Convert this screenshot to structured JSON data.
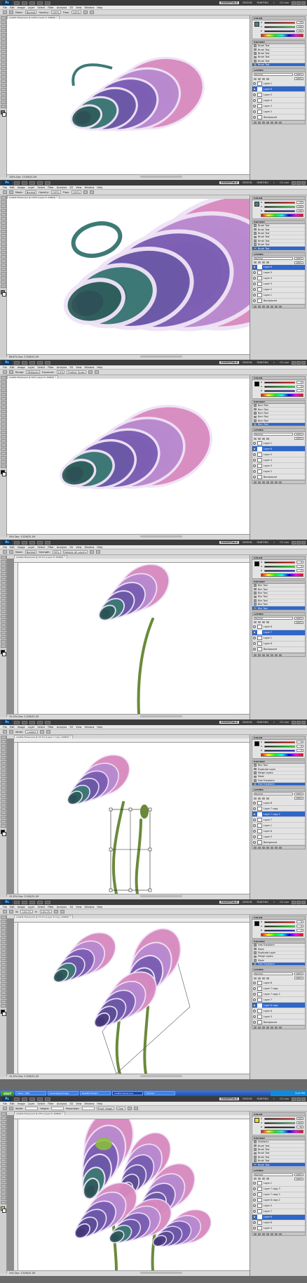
{
  "app": {
    "logo": "Ps",
    "workspaces": [
      "ESSENTIALS",
      "DESIGN",
      "PAINTING"
    ],
    "more": "»",
    "cs_live": "CS Live"
  },
  "menu": [
    "File",
    "Edit",
    "Image",
    "Layer",
    "Select",
    "Filter",
    "Analysis",
    "3D",
    "View",
    "Window",
    "Help"
  ],
  "panels": [
    {
      "doc_tab": "rosette flower.psd @ 100% (Layer 6, RGB/8) *",
      "options": [
        {
          "label": "Mode:",
          "value": "Normal"
        },
        {
          "label": "Opacity:",
          "value": "100%"
        },
        {
          "label": "Flow:",
          "value": "100%"
        }
      ],
      "status": "100%  Doc: 3.52M/25.1M",
      "color_values": [
        "73",
        "126",
        "140"
      ],
      "history_title": "HISTORY",
      "history": [
        "Brush Tool",
        "Brush Tool",
        "Brush Tool",
        "Brush Tool",
        "Brush Tool",
        "Brush Tool"
      ],
      "layers": [
        "Layer 1",
        "Layer 6",
        "Layer 5",
        "Layer 4",
        "Layer 3",
        "Layer 2",
        "Background"
      ],
      "selected_layer": 1
    },
    {
      "doc_tab": "rosette flower.psd @ 100% (Layer 6, RGB/8) *",
      "options": [
        {
          "label": "Mode:",
          "value": "Normal"
        },
        {
          "label": "Opacity:",
          "value": "100%"
        },
        {
          "label": "Flow:",
          "value": "100%"
        }
      ],
      "status": "66.67%  Doc: 3.52M/25.1M",
      "color_values": [
        "73",
        "126",
        "140"
      ],
      "history_title": "HISTORY",
      "history": [
        "Brush Tool",
        "Brush Tool",
        "Brush Tool",
        "Brush Tool",
        "Brush Tool",
        "Brush Tool",
        "Brush Tool"
      ],
      "layers": [
        "Layer 6",
        "Layer 5",
        "Layer 4",
        "Layer 3",
        "Layer 2",
        "Layer 1",
        "Background"
      ],
      "selected_layer": 0
    },
    {
      "doc_tab": "rosette flower.psd @ 50% (Layer 6, RGB/8) *",
      "options": [
        {
          "label": "Range:",
          "value": "Midtones"
        },
        {
          "label": "Exposure:",
          "value": "15%"
        },
        {
          "label": "",
          "value": "Protect Tones"
        }
      ],
      "status": "50%  Doc: 3.52M/25.1M",
      "color_values": [
        "0",
        "0",
        "0"
      ],
      "history_title": "HISTORY",
      "history": [
        "Burn Tool",
        "Burn Tool",
        "Burn Tool",
        "Burn Tool",
        "Burn Tool",
        "Burn Tool"
      ],
      "layers": [
        "Layer 1",
        "Layer 6",
        "Layer 5",
        "Layer 4",
        "Layer 3",
        "Layer 2",
        "Background"
      ],
      "selected_layer": 1
    },
    {
      "doc_tab": "rosette flower.psd @ 33.3% (Layer 8, RGB/8) *",
      "options": [
        {
          "label": "Mode:",
          "value": "Normal"
        },
        {
          "label": "Strength:",
          "value": "50%"
        },
        {
          "label": "",
          "value": "Sample All Layers"
        }
      ],
      "status": "33.33%  Doc: 3.52M/25.1M",
      "color_values": [
        "0",
        "0",
        "0"
      ],
      "history_title": "HISTORY",
      "history": [
        "Blur Tool",
        "Blur Tool",
        "Blur Tool",
        "Blur Tool",
        "Blur Tool",
        "Blur Tool",
        "Blur Tool"
      ],
      "layers": [
        "Layer 8",
        "Layer 7",
        "Layer 1",
        "Layer 6",
        "Background"
      ],
      "selected_layer": 1
    },
    {
      "doc_tab": "rosette flower.psd @ 33.3% (Layer 7 copy, RGB/8) *",
      "options": [
        {
          "label": "Width:",
          "value": "Custom"
        }
      ],
      "status": "33.33%  Doc: 3.52M/25.1M",
      "color_values": [
        "0",
        "0",
        "0"
      ],
      "history_title": "HISTORY",
      "history": [
        "Blur Tool",
        "Duplicate Layer",
        "Merge Layers",
        "Move",
        "Free Transform",
        "Free Transform"
      ],
      "layers": [
        "Layer 8",
        "Layer 7 copy",
        "Layer 7 copy 2",
        "Layer 7",
        "Layer 1",
        "Layer 6",
        "Layer 5",
        "Background"
      ],
      "selected_layer": 2
    },
    {
      "doc_tab": "rosette flower.psd @ 33.3% (Layer 8 copy, RGB/8) *",
      "options": [
        {
          "label": "W:",
          "value": "100.0%"
        },
        {
          "label": "H:",
          "value": "100.0%"
        }
      ],
      "status": "33.33%  Doc: 3.52M/25.1M",
      "color_values": [
        "0",
        "0",
        "0"
      ],
      "history_title": "HISTORY",
      "history": [
        "Free Transform",
        "Move",
        "Duplicate Layer",
        "Merge Layers",
        "Move",
        "Free Transform"
      ],
      "layers": [
        "Layer 8",
        "Layer 7 copy",
        "Layer 7 copy 2",
        "Layer 7",
        "Layer 8 copy",
        "Layer 6",
        "Layer 5",
        "Background"
      ],
      "selected_layer": 4
    },
    {
      "doc_tab": "rosette flower.psd @ 25% (Layer 8, RGB/8) *",
      "options": [
        {
          "label": "Width:",
          "value": ""
        },
        {
          "label": "Height:",
          "value": ""
        },
        {
          "label": "Resolution:",
          "value": ""
        },
        {
          "label": "",
          "value": "Front Image"
        },
        {
          "label": "",
          "value": "Clear"
        }
      ],
      "status": "25%  Doc: 3.52M/25.1M",
      "color_values": [
        "224",
        "224",
        "30"
      ],
      "history_title": "HISTORY",
      "history": [
        "Untitled-1",
        "Brush Tool",
        "Brush Tool",
        "Brush Tool",
        "Brush Tool",
        "Brush Tool",
        "Brush Tool"
      ],
      "layers": [
        "Layer 1",
        "Layer 7 copy 3",
        "Layer 7 copy 2",
        "Layer 8 copy 2",
        "Layer 5",
        "Layer 7",
        "Layer 6",
        "Layer 8",
        "Layer 4"
      ],
      "selected_layer": 6
    }
  ],
  "taskbar": {
    "start": "start",
    "tasks": [
      "Inbox - Mail",
      "Leveraging Image",
      "Rosette flowers",
      "rosette flower.psd",
      "Tutorial"
    ],
    "clock": "3:24 PM"
  },
  "colors": {
    "teal": "#3d7a76",
    "purple": "#7c5fb4",
    "pink": "#d88ac0",
    "stem": "#6a8a3a",
    "selection": "#2f66c8"
  }
}
